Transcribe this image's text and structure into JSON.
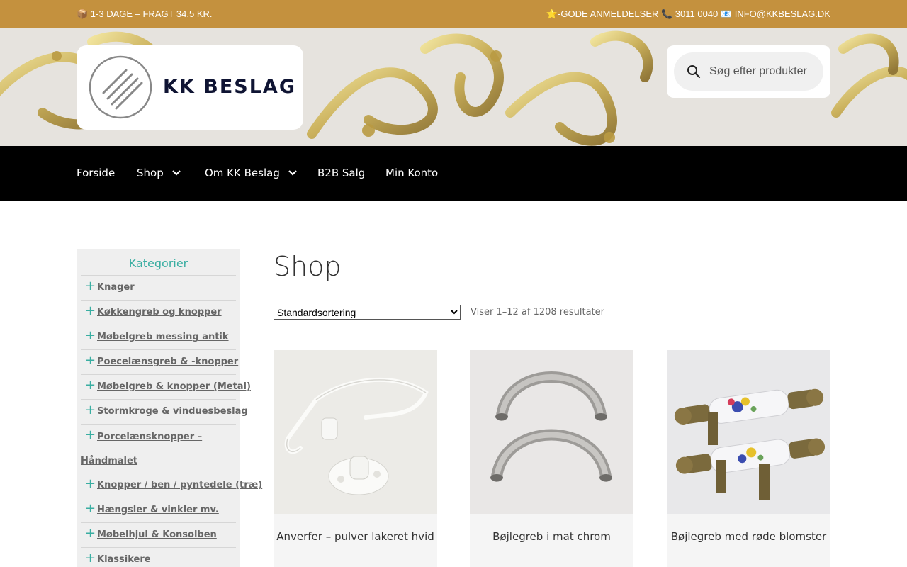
{
  "topbar": {
    "shipping": "📦 1-3 DAGE – FRAGT 34,5 KR.",
    "contact": "⭐-GODE ANMELDELSER 📞 3011 0040 📧 INFO@KKBESLAG.DK"
  },
  "header": {
    "brand": "KK BESLAG",
    "search_placeholder": "Søg efter produkter"
  },
  "nav": {
    "items": [
      {
        "label": "Forside",
        "has_dropdown": false
      },
      {
        "label": "Shop",
        "has_dropdown": true
      },
      {
        "label": "Om KK Beslag",
        "has_dropdown": true
      },
      {
        "label": "B2B Salg",
        "has_dropdown": false
      },
      {
        "label": "Min Konto",
        "has_dropdown": false
      }
    ]
  },
  "sidebar": {
    "title": "Kategorier",
    "categories": [
      "Knager",
      "Køkkengreb og knopper",
      "Møbelgreb messing antik",
      "Poecelænsgreb & -knopper",
      "Møbelgreb & knopper (Metal)",
      "Stormkroge & vinduesbeslag",
      "Porcelænsknopper – Håndmalet",
      "Knopper / ben / pyntedele (træ)",
      "Hængsler & vinkler mv.",
      "Møbelhjul & Konsolben",
      "Klassikere"
    ]
  },
  "main": {
    "title": "Shop",
    "sort_selected": "Standardsortering",
    "result_count": "Viser 1–12 af 1208 resultater",
    "products": [
      {
        "name": "Anverfer – pulver lakeret hvid"
      },
      {
        "name": "Bøjlegreb i mat chrom"
      },
      {
        "name": "Bøjlegreb med røde blomster"
      }
    ]
  },
  "colors": {
    "topbar": "#c4913e",
    "nav": "#000000",
    "accent": "#3aaea2"
  }
}
